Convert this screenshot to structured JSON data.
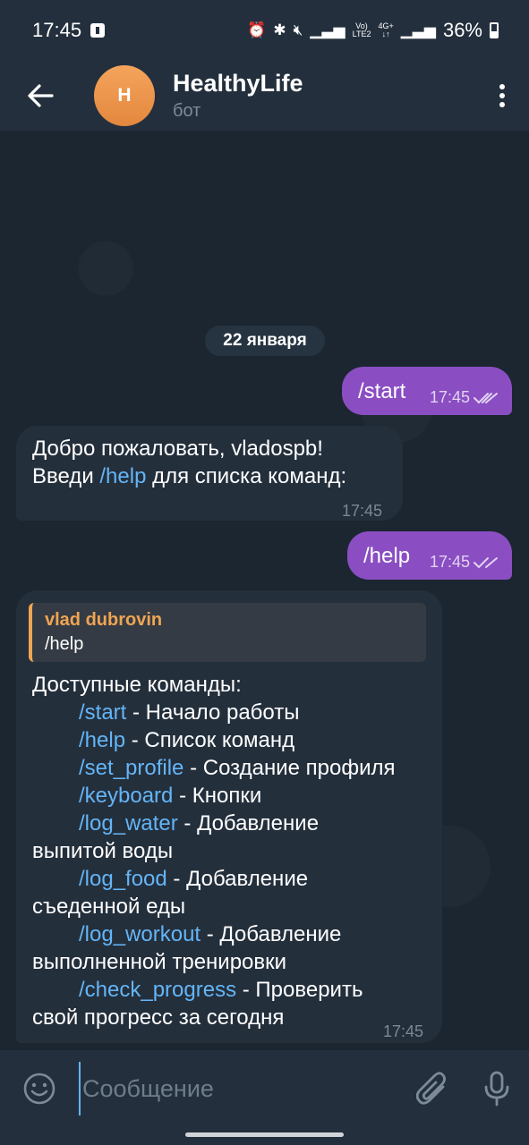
{
  "status_bar": {
    "time": "17:45",
    "network_vo": "Vo)",
    "network_lte": "LTE2",
    "network_4g": "4G+",
    "battery": "36%"
  },
  "header": {
    "back_icon": "arrow-left-icon",
    "avatar_letter": "H",
    "avatar_color": "#f0974a",
    "title": "HealthyLife",
    "subtitle": "бот",
    "menu_icon": "more-vertical-icon"
  },
  "chat": {
    "date": "22 января",
    "messages": [
      {
        "direction": "out",
        "text": "/start",
        "time": "17:45"
      },
      {
        "direction": "in",
        "line1": "Добро пожаловать, vladospb!",
        "line2_pre": "Введи ",
        "line2_cmd": "/help",
        "line2_post": " для списка команд:",
        "time": "17:45"
      },
      {
        "direction": "out",
        "text": "/help",
        "time": "17:45"
      },
      {
        "direction": "in",
        "reply_author": "vlad dubrovin",
        "reply_text": "/help",
        "heading": "Доступные команды:",
        "commands": [
          {
            "cmd": "/start",
            "desc": " - Начало работы"
          },
          {
            "cmd": "/help",
            "desc": " - Список команд"
          },
          {
            "cmd": "/set_profile",
            "desc": " - Создание профиля"
          },
          {
            "cmd": "/keyboard",
            "desc": " - Кнопки"
          },
          {
            "cmd": "/log_water",
            "desc": " - Добавление",
            "cont": "выпитой воды"
          },
          {
            "cmd": "/log_food",
            "desc": " - Добавление",
            "cont": "съеденной еды"
          },
          {
            "cmd": "/log_workout",
            "desc": " - Добавление",
            "cont": "выполненной тренировки"
          },
          {
            "cmd": "/check_progress",
            "desc": " - Проверить",
            "cont": "свой прогресс за сегодня"
          }
        ],
        "time": "17:45"
      }
    ]
  },
  "input": {
    "placeholder": "Сообщение",
    "value": ""
  },
  "colors": {
    "outgoing_bubble": "#8a4ec2",
    "incoming_bubble": "#242f3c",
    "command_link": "#64b5f6",
    "reply_accent": "#f0a552"
  }
}
